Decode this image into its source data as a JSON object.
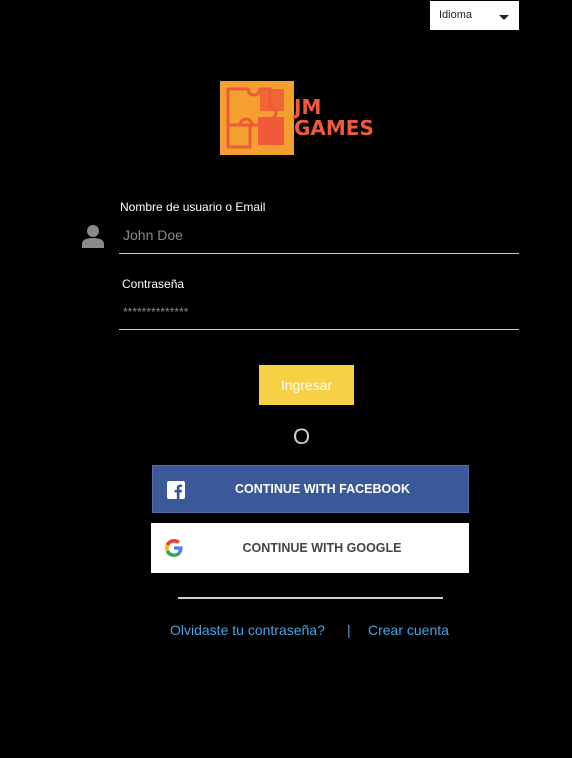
{
  "language": {
    "label": "Idioma"
  },
  "logo": {
    "line1": "JM",
    "line2": "GAMES",
    "tile_color": "#f4a030",
    "text_color": "#f05a3a"
  },
  "form": {
    "username": {
      "label": "Nombre de usuario o Email",
      "placeholder": "John Doe"
    },
    "password": {
      "label": "Contraseña",
      "placeholder": "**************"
    },
    "submit_label": "Ingresar"
  },
  "or_text": "O",
  "social": {
    "facebook_label": "CONTINUE WITH FACEBOOK",
    "google_label": "CONTINUE WITH GOOGLE"
  },
  "links": {
    "forgot": "Olvidaste tu contraseña?",
    "separator": "|",
    "register": "Crear cuenta"
  },
  "colors": {
    "accent": "#f7d046",
    "facebook": "#3b5998",
    "link": "#47a3e6"
  },
  "icons": [
    "chevron-down-icon",
    "user-icon",
    "facebook-icon",
    "google-icon"
  ]
}
